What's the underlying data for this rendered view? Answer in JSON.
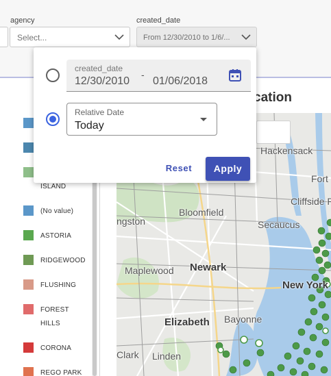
{
  "filters": {
    "agency": {
      "label": "agency",
      "placeholder": "Select..."
    },
    "created_date": {
      "label": "created_date",
      "value": "From 12/30/2010 to 1/6/..."
    }
  },
  "popup": {
    "date_range": {
      "label": "created_date",
      "from": "12/30/2010",
      "separator": "-",
      "to": "01/06/2018"
    },
    "relative": {
      "label": "Relative Date",
      "value": "Today"
    },
    "reset_label": "Reset",
    "apply_label": "Apply",
    "accent_color": "#3f51b5"
  },
  "map": {
    "title_partial": "cation",
    "places": [
      "Hackensack",
      "Fort",
      "Cliffside Pa",
      "ngston",
      "Bloomfield",
      "Secaucus",
      "Newark",
      "Maplewood",
      "New York",
      "Elizabeth",
      "Bayonne",
      "Clark",
      "Linden"
    ]
  },
  "legend": {
    "items": [
      {
        "label": "",
        "color": "#5b97c9"
      },
      {
        "label": "",
        "color": "#4c87ae"
      },
      {
        "label": "ISLAND",
        "color": "#8fbf8a"
      },
      {
        "label": "(No value)",
        "color": "#5b97c9"
      },
      {
        "label": "ASTORIA",
        "color": "#5aa84f"
      },
      {
        "label": "RIDGEWOOD",
        "color": "#6f9a54"
      },
      {
        "label": "FLUSHING",
        "color": "#d89a88"
      },
      {
        "label": "FOREST",
        "color": "#e06b6b"
      },
      {
        "label": "HILLS",
        "color": ""
      },
      {
        "label": "CORONA",
        "color": "#d43a3a"
      },
      {
        "label": "REGO PARK",
        "color": "#e0724f"
      }
    ]
  }
}
